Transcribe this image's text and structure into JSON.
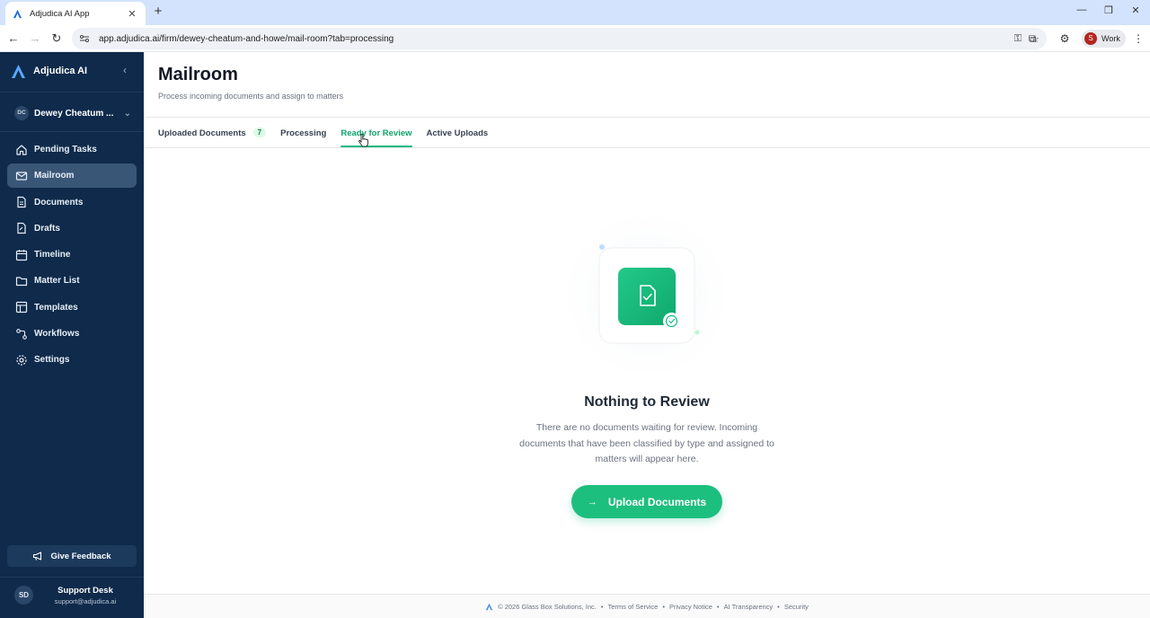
{
  "browser": {
    "tab_title": "Adjudica AI App",
    "tab_close": "✕",
    "new_tab": "+",
    "url": "app.adjudica.ai/firm/dewey-cheatum-and-howe/mail-room?tab=processing",
    "profile_initial": "S",
    "profile_label": "Work"
  },
  "sidebar": {
    "brand": "Adjudica AI",
    "firm_initials": "DC",
    "firm_name": "Dewey Cheatum ...",
    "items": [
      {
        "label": "Pending Tasks",
        "icon": "home-icon"
      },
      {
        "label": "Mailroom",
        "icon": "mail-icon"
      },
      {
        "label": "Documents",
        "icon": "document-icon"
      },
      {
        "label": "Drafts",
        "icon": "drafts-icon"
      },
      {
        "label": "Timeline",
        "icon": "calendar-icon"
      },
      {
        "label": "Matter List",
        "icon": "folder-icon"
      },
      {
        "label": "Templates",
        "icon": "templates-icon"
      },
      {
        "label": "Workflows",
        "icon": "workflow-icon"
      },
      {
        "label": "Settings",
        "icon": "gear-icon"
      }
    ],
    "active_item": "Mailroom",
    "feedback_label": "Give Feedback",
    "user_initials": "SD",
    "user_name": "Support Desk",
    "user_email": "support@adjudica.ai"
  },
  "main": {
    "title": "Mailroom",
    "subtitle": "Process incoming documents and assign to matters",
    "tabs": [
      {
        "label": "Uploaded Documents",
        "count": "7"
      },
      {
        "label": "Processing"
      },
      {
        "label": "Ready for Review"
      },
      {
        "label": "Active Uploads"
      }
    ],
    "active_tab": "Ready for Review",
    "empty_title": "Nothing to Review",
    "empty_text": "There are no documents waiting for review. Incoming documents that have been classified by type and assigned to matters will appear here.",
    "upload_label": "Upload Documents"
  },
  "footer": {
    "copyright": "© 2026 Glass Box Solutions, Inc.",
    "links": [
      "Terms of Service",
      "Privacy Notice",
      "AI Transparency",
      "Security"
    ]
  },
  "colors": {
    "sidebar_bg": "#0f2a4a",
    "accent_green": "#1dbf7e",
    "active_nav": "#3a5677"
  }
}
